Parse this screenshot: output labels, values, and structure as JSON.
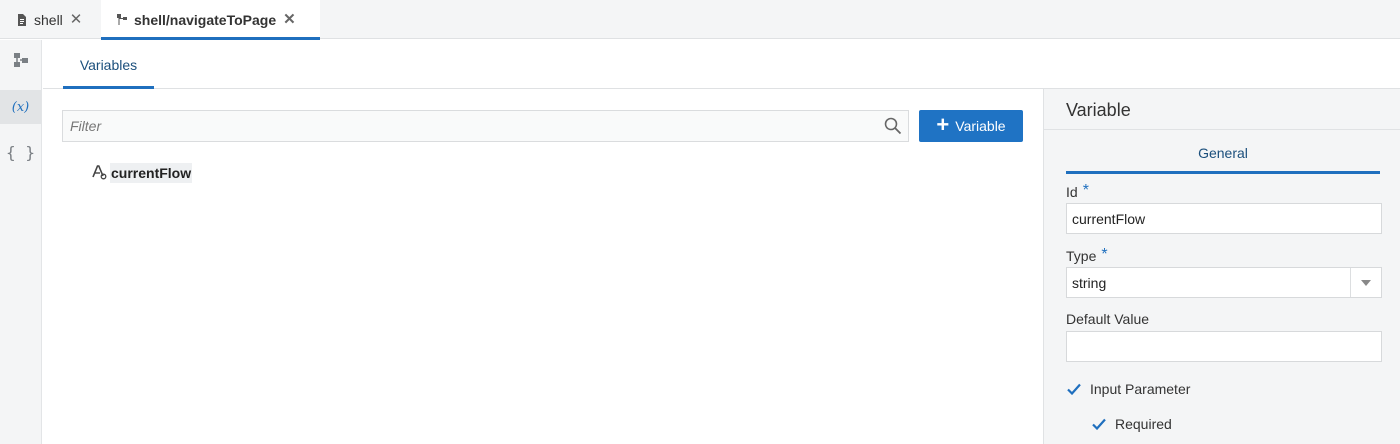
{
  "tabs": [
    {
      "label": "shell",
      "icon": "file-icon",
      "active": false
    },
    {
      "label": "shell/navigateToPage",
      "icon": "flow-icon",
      "active": true
    }
  ],
  "sidebar": {
    "items": [
      {
        "icon": "flow-diagram-icon",
        "active": false
      },
      {
        "icon": "variable-icon",
        "label": "(x)",
        "active": true
      },
      {
        "icon": "json-braces-icon",
        "label": "{ }",
        "active": false
      }
    ]
  },
  "main": {
    "tab_label": "Variables",
    "filter": {
      "placeholder": "Filter",
      "value": ""
    },
    "add_button_label": "Variable",
    "variables": [
      {
        "name": "currentFlow",
        "type_icon": "string-type-icon"
      }
    ]
  },
  "panel": {
    "title": "Variable",
    "tab_label": "General",
    "id_label": "Id",
    "id_value": "currentFlow",
    "type_label": "Type",
    "type_value": "string",
    "default_label": "Default Value",
    "default_value": "",
    "required_mark": "*",
    "input_param_label": "Input Parameter",
    "input_param_checked": true,
    "required_label": "Required",
    "required_checked": true
  },
  "colors": {
    "accent": "#1f6fbe",
    "button": "#1f73c4",
    "panel_bg": "#f4f5f6"
  }
}
